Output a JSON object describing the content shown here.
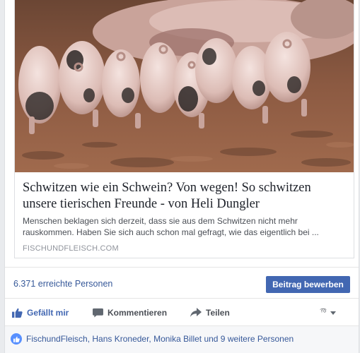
{
  "link_preview": {
    "image_alt": "Ferkel beim Säugen im Schlamm",
    "title": "Schwitzen wie ein Schwein? Von wegen! So schwitzen unsere tierischen Freunde - von Heli Dungler",
    "description": "Menschen beklagen sich derzeit, dass sie aus dem Schwitzen nicht mehr rauskommen. Haben Sie sich auch schon mal gefragt, wie das eigentlich bei ...",
    "domain": "FISCHUNDFLEISCH.COM"
  },
  "reach": {
    "text": "6.371 erreichte Personen",
    "promote_label": "Beitrag bewerben"
  },
  "actions": {
    "like": "Gefällt mir",
    "comment": "Kommentieren",
    "share": "Teilen",
    "reaction_icon": "emoji-face-icon"
  },
  "likes": {
    "text": "FischundFleisch, Hans Kroneder, Monika Billet und 9 weitere Personen"
  },
  "colors": {
    "link_blue": "#365899",
    "button_blue": "#4267b2",
    "like_badge": "#5890ff"
  }
}
